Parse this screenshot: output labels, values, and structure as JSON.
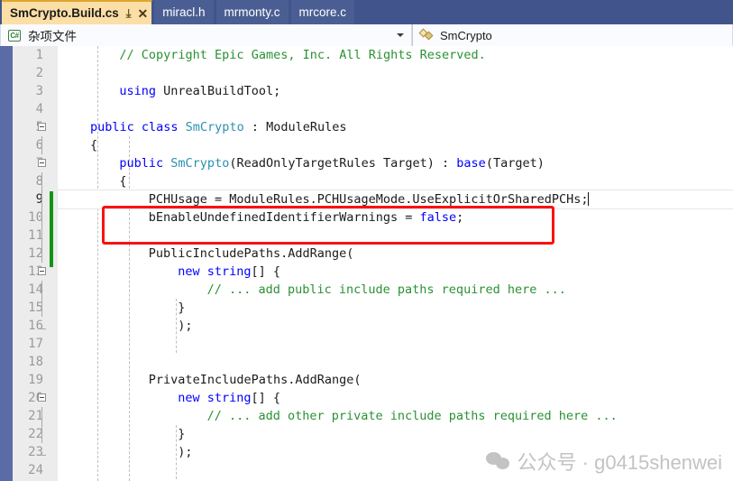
{
  "window": {
    "app": "Visual Studio code editor"
  },
  "tabs": {
    "items": [
      {
        "label": "SmCrypto.Build.cs",
        "active": true,
        "pin_icon": "pin-icon",
        "close_icon": "close-icon"
      },
      {
        "label": "miracl.h",
        "active": false
      },
      {
        "label": "mrmonty.c",
        "active": false
      },
      {
        "label": "mrcore.c",
        "active": false
      }
    ]
  },
  "navbar": {
    "project_combo": {
      "icon": "csharp-file-icon",
      "value": "杂项文件",
      "arrow_icon": "chevron-down-icon"
    },
    "type_combo": {
      "icon": "class-icon",
      "value": "SmCrypto"
    }
  },
  "editor": {
    "current_line": 9,
    "change_bar_color": "#119611",
    "annotation_color": "#f91212",
    "lines": [
      {
        "n": 1,
        "indent": 4,
        "tokens": [
          {
            "t": "// Copyright Epic Games, Inc. All Rights Reserved.",
            "c": "cmt"
          }
        ]
      },
      {
        "n": 2,
        "indent": 0,
        "tokens": []
      },
      {
        "n": 3,
        "indent": 4,
        "tokens": [
          {
            "t": "using ",
            "c": "kw"
          },
          {
            "t": "UnrealBuildTool;",
            "c": "pln"
          }
        ]
      },
      {
        "n": 4,
        "indent": 0,
        "tokens": []
      },
      {
        "n": 5,
        "indent": 0,
        "tokens": [
          {
            "t": "public class ",
            "c": "kw"
          },
          {
            "t": "SmCrypto",
            "c": "type"
          },
          {
            "t": " : ModuleRules",
            "c": "pln"
          }
        ]
      },
      {
        "n": 6,
        "indent": 0,
        "tokens": [
          {
            "t": "{",
            "c": "pln"
          }
        ]
      },
      {
        "n": 7,
        "indent": 4,
        "tokens": [
          {
            "t": "public ",
            "c": "kw"
          },
          {
            "t": "SmCrypto",
            "c": "type"
          },
          {
            "t": "(ReadOnlyTargetRules Target) : ",
            "c": "pln"
          },
          {
            "t": "base",
            "c": "kw"
          },
          {
            "t": "(Target)",
            "c": "pln"
          }
        ]
      },
      {
        "n": 8,
        "indent": 4,
        "tokens": [
          {
            "t": "{",
            "c": "pln"
          }
        ]
      },
      {
        "n": 9,
        "indent": 8,
        "tokens": [
          {
            "t": "PCHUsage = ModuleRules.PCHUsageMode.UseExplicitOrSharedPCHs;",
            "c": "pln"
          }
        ]
      },
      {
        "n": 10,
        "indent": 8,
        "tokens": [
          {
            "t": "bEnableUndefinedIdentifierWarnings = ",
            "c": "pln"
          },
          {
            "t": "false",
            "c": "kw"
          },
          {
            "t": ";",
            "c": "pln"
          }
        ]
      },
      {
        "n": 11,
        "indent": 0,
        "tokens": []
      },
      {
        "n": 12,
        "indent": 8,
        "tokens": [
          {
            "t": "PublicIncludePaths.AddRange(",
            "c": "pln"
          }
        ]
      },
      {
        "n": 13,
        "indent": 12,
        "tokens": [
          {
            "t": "new ",
            "c": "kw"
          },
          {
            "t": "string",
            "c": "kw"
          },
          {
            "t": "[] {",
            "c": "pln"
          }
        ]
      },
      {
        "n": 14,
        "indent": 16,
        "tokens": [
          {
            "t": "// ... add public include paths required here ...",
            "c": "cmt"
          }
        ]
      },
      {
        "n": 15,
        "indent": 12,
        "tokens": [
          {
            "t": "}",
            "c": "pln"
          }
        ]
      },
      {
        "n": 16,
        "indent": 12,
        "tokens": [
          {
            "t": ");",
            "c": "pln"
          }
        ]
      },
      {
        "n": 17,
        "indent": 0,
        "tokens": []
      },
      {
        "n": 18,
        "indent": 0,
        "tokens": []
      },
      {
        "n": 19,
        "indent": 8,
        "tokens": [
          {
            "t": "PrivateIncludePaths.AddRange(",
            "c": "pln"
          }
        ]
      },
      {
        "n": 20,
        "indent": 12,
        "tokens": [
          {
            "t": "new ",
            "c": "kw"
          },
          {
            "t": "string",
            "c": "kw"
          },
          {
            "t": "[] {",
            "c": "pln"
          }
        ]
      },
      {
        "n": 21,
        "indent": 16,
        "tokens": [
          {
            "t": "// ... add other private include paths required here ...",
            "c": "cmt"
          }
        ]
      },
      {
        "n": 22,
        "indent": 12,
        "tokens": [
          {
            "t": "}",
            "c": "pln"
          }
        ]
      },
      {
        "n": 23,
        "indent": 12,
        "tokens": [
          {
            "t": ");",
            "c": "pln"
          }
        ]
      },
      {
        "n": 24,
        "indent": 0,
        "tokens": []
      }
    ]
  },
  "watermark": {
    "icon": "wechat-icon",
    "text": "公众号 · g0415shenwei"
  }
}
